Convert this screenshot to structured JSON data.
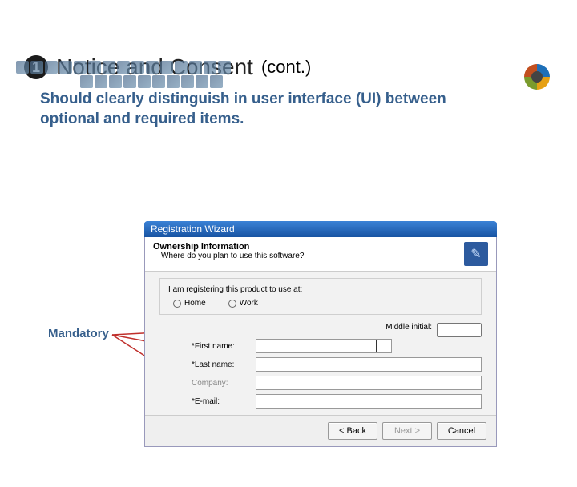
{
  "heading": {
    "number": "1",
    "title": "Notice and Consent",
    "cont": "(cont.)"
  },
  "subheading": "Should clearly distinguish in user interface (UI) between optional and required items.",
  "annotation": {
    "mandatory": "Mandatory"
  },
  "dialog": {
    "title": "Registration Wizard",
    "banner": {
      "title": "Ownership Information",
      "subtitle": "Where do you plan to use this software?"
    },
    "group": {
      "label": "I am registering this product to use at:",
      "option_home": "Home",
      "option_work": "Work"
    },
    "fields": {
      "middle_initial": "Middle initial:",
      "first_name": "*First name:",
      "last_name": "*Last name:",
      "company": "Company:",
      "email": "*E-mail:"
    },
    "buttons": {
      "back": "< Back",
      "next": "Next >",
      "cancel": "Cancel"
    }
  }
}
